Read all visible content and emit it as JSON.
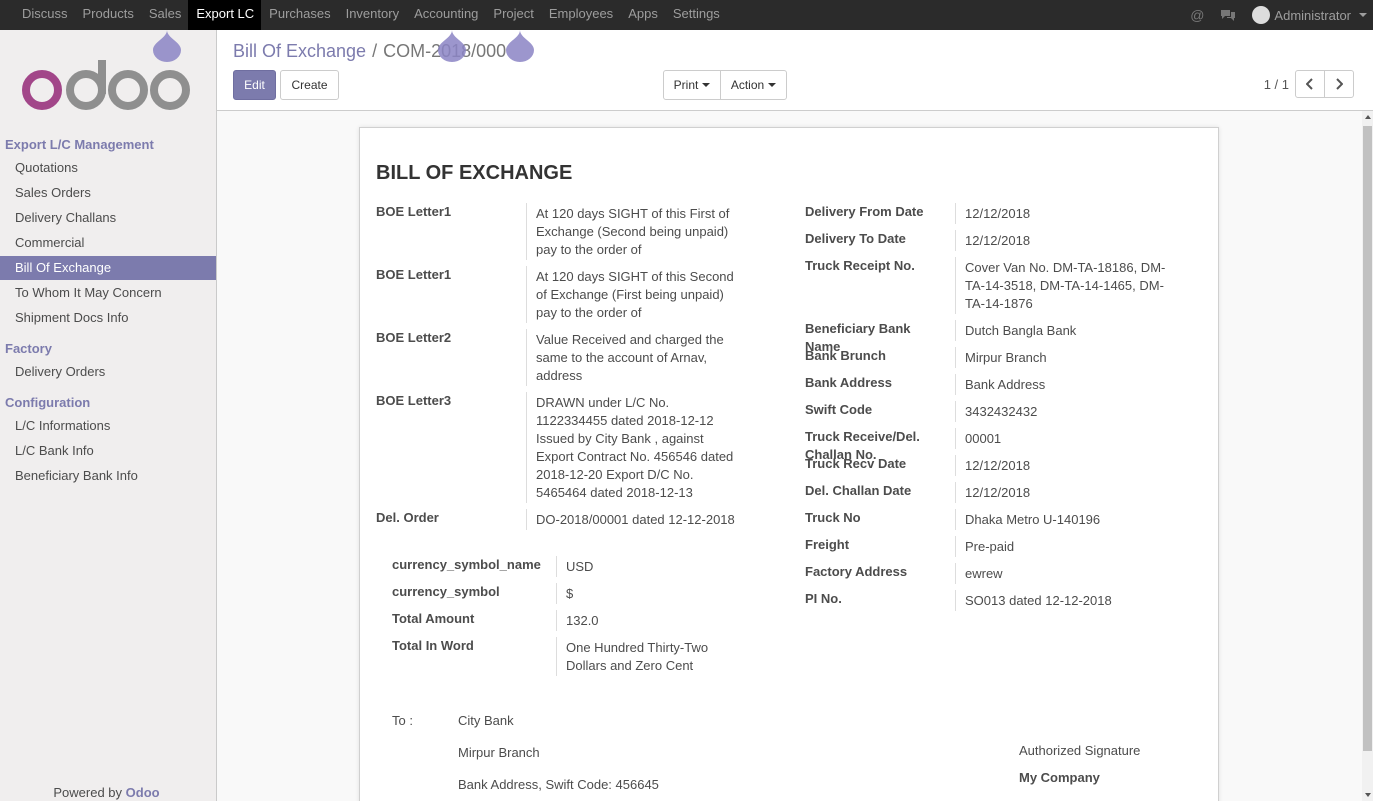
{
  "menu": [
    "Discuss",
    "Products",
    "Sales",
    "Export LC",
    "Purchases",
    "Inventory",
    "Accounting",
    "Project",
    "Employees",
    "Apps",
    "Settings"
  ],
  "user": {
    "name": "Administrator"
  },
  "sidebar": {
    "sections": [
      {
        "title": "Export L/C Management",
        "items": [
          "Quotations",
          "Sales Orders",
          "Delivery Challans",
          "Commercial",
          "Bill Of Exchange",
          "To Whom It May Concern",
          "Shipment Docs Info"
        ]
      },
      {
        "title": "Factory",
        "items": [
          "Delivery Orders"
        ]
      },
      {
        "title": "Configuration",
        "items": [
          "L/C Informations",
          "L/C Bank Info",
          "Beneficiary Bank Info"
        ]
      }
    ],
    "active_item": "Bill Of Exchange",
    "powered_by": "Powered by",
    "powered_brand": "Odoo"
  },
  "breadcrumb": {
    "parent": "Bill Of Exchange",
    "separator": "/",
    "current": "COM-2018/000"
  },
  "toolbar": {
    "edit": "Edit",
    "create": "Create",
    "print": "Print",
    "action": "Action"
  },
  "pager": {
    "text": "1 / 1"
  },
  "report": {
    "title": "BILL OF EXCHANGE",
    "left_fields": [
      {
        "label": "BOE Letter1",
        "lines": [
          "At 120 days SIGHT of this First of",
          "Exchange (Second being unpaid)",
          "pay to the order of"
        ]
      },
      {
        "label": "BOE Letter1",
        "lines": [
          "At 120 days SIGHT of this Second",
          "of Exchange (First being unpaid)",
          "pay to the order of"
        ]
      },
      {
        "label": "BOE Letter2",
        "lines": [
          "Value Received and charged the",
          "same to the account of Arnav,",
          "address"
        ]
      },
      {
        "label": "BOE Letter3",
        "lines": [
          "DRAWN under L/C No.",
          "1122334455 dated 2018-12-12",
          "Issued by City Bank , against",
          "Export Contract No. 456546 dated",
          "2018-12-20 Export D/C No.",
          "5465464 dated 2018-12-13"
        ]
      },
      {
        "label": "Del. Order",
        "lines": [
          "DO-2018/00001 dated 12-12-2018"
        ]
      }
    ],
    "amount_fields": [
      {
        "label": "currency_symbol_name",
        "lines": [
          "USD"
        ]
      },
      {
        "label": "currency_symbol",
        "lines": [
          "$"
        ]
      },
      {
        "label": "Total Amount",
        "lines": [
          "132.0"
        ]
      },
      {
        "label": "Total In Word",
        "lines": [
          "One Hundred Thirty-Two",
          "Dollars and Zero Cent"
        ]
      }
    ],
    "right_fields": [
      {
        "label": "Delivery From Date",
        "lines": [
          "12/12/2018"
        ]
      },
      {
        "label": "Delivery To Date",
        "lines": [
          "12/12/2018"
        ]
      },
      {
        "label": "Truck Receipt No.",
        "lines": [
          "Cover Van No. DM-TA-18186, DM-",
          "TA-14-3518, DM-TA-14-1465, DM-",
          "TA-14-1876"
        ]
      },
      {
        "label": "Beneficiary Bank\nName",
        "lines": [
          "Dutch Bangla Bank"
        ]
      },
      {
        "label": "Bank Brunch",
        "lines": [
          "Mirpur Branch"
        ]
      },
      {
        "label": "Bank Address",
        "lines": [
          "Bank Address"
        ]
      },
      {
        "label": "Swift Code",
        "lines": [
          "3432432432"
        ]
      },
      {
        "label": "Truck Receive/Del.\nChallan No.",
        "lines": [
          "00001"
        ]
      },
      {
        "label": "Truck Recv Date",
        "lines": [
          "12/12/2018"
        ]
      },
      {
        "label": "Del. Challan Date",
        "lines": [
          "12/12/2018"
        ]
      },
      {
        "label": "Truck No",
        "lines": [
          "Dhaka Metro U-140196"
        ]
      },
      {
        "label": "Freight",
        "lines": [
          "Pre-paid"
        ]
      },
      {
        "label": "Factory Address",
        "lines": [
          "ewrew"
        ]
      },
      {
        "label": "PI No.",
        "lines": [
          "SO013 dated 12-12-2018"
        ]
      }
    ],
    "to_label": "To :",
    "to_lines": [
      "City Bank",
      "Mirpur Branch",
      "Bank Address, Swift Code: 456645"
    ],
    "signature_label": "Authorized Signature",
    "company": "My Company"
  },
  "colors": {
    "brand": "#7c7bad",
    "topbar": "#2b2b2b"
  }
}
